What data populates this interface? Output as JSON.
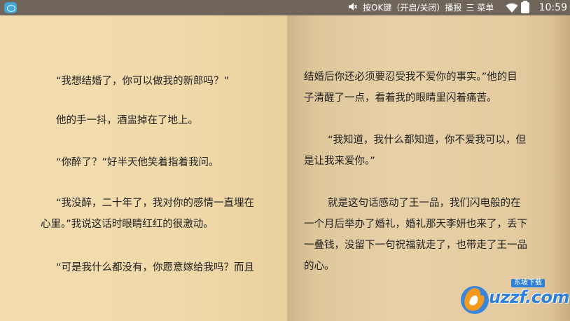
{
  "status_bar": {
    "hint": "按OK键（开启/关闭）播报",
    "menu_glyph": "三",
    "menu_label": "菜单",
    "time": "10:59"
  },
  "left_page": {
    "paragraphs": [
      "“我想结婚了，你可以做我的新郎吗？”",
      "他的手一抖，酒盅掉在了地上。",
      "“你醉了？”好半天他笑着指着我问。",
      "“我没醉，二十年了，我对你的感情一直埋在",
      "心里。”我说这话时眼睛红红的很激动。",
      "“可是我什么都没有，你愿意嫁给我吗？而且"
    ]
  },
  "right_page": {
    "paragraphs": [
      "结婚后你还必须要忍受我不爱你的事实。”他的目",
      "子清醒了一点，看着我的眼睛里闪着痛苦。",
      "“我知道，我什么都知道，你不爱我可以，但",
      "是让我来爱你。”",
      "就是这句话感动了王一品，我们闪电般的在",
      "一个月后举办了婚礼，婚礼那天李妍也来了，丢下",
      "一叠钱，没留下一句祝福就走了，也带走了王一品",
      "的心。"
    ]
  },
  "watermark": {
    "tag": "东坡下载",
    "text": "uzzf.com"
  }
}
